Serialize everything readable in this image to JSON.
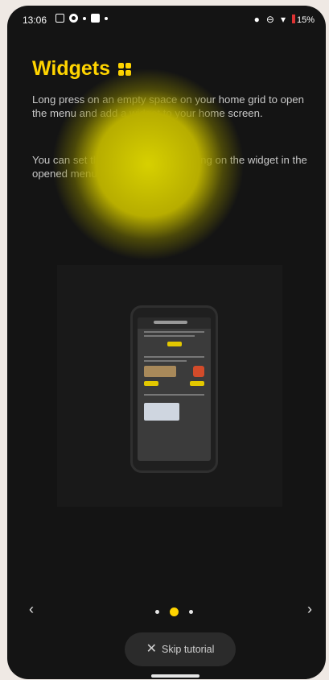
{
  "status": {
    "time": "13:06",
    "battery": "15%"
  },
  "header": {
    "title": "Widgets",
    "icon": "widgets-grid-icon"
  },
  "body": {
    "p1": "Long press on an empty space on your home grid to open the menu and add a widget to your home screen.",
    "p2": "You can set the widget size by clicking on the widget in the opened menu."
  },
  "nav": {
    "prev_icon": "chevron-left-icon",
    "next_icon": "chevron-right-icon",
    "page_count": 3,
    "active_page": 2,
    "skip_label": "Skip tutorial"
  },
  "colors": {
    "accent": "#ffd400",
    "background": "#141414"
  }
}
